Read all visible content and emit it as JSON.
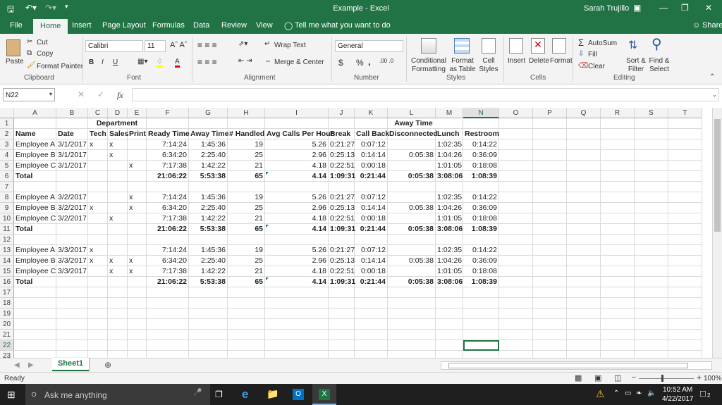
{
  "title": "Example  -  Excel",
  "user": "Sarah Trujillo",
  "tabs": [
    "File",
    "Home",
    "Insert",
    "Page Layout",
    "Formulas",
    "Data",
    "Review",
    "View"
  ],
  "tell_me": "Tell me what you want to do",
  "share": "Share",
  "clipboard": {
    "paste": "Paste",
    "cut": "Cut",
    "copy": "Copy",
    "format_painter": "Format Painter",
    "label": "Clipboard"
  },
  "font": {
    "name": "Calibri",
    "size": "11",
    "label": "Font",
    "bold": "B",
    "italic": "I",
    "underline": "U"
  },
  "alignment": {
    "wrap": "Wrap Text",
    "merge": "Merge & Center",
    "label": "Alignment"
  },
  "number": {
    "format": "General",
    "currency": "$",
    "percent": "%",
    "comma": ",",
    "label": "Number"
  },
  "styles": {
    "conditional": "Conditional Formatting",
    "format_table": "Format as Table",
    "cell_styles": "Cell Styles",
    "label": "Styles"
  },
  "cells": {
    "insert": "Insert",
    "delete": "Delete",
    "format": "Format",
    "label": "Cells"
  },
  "editing": {
    "autosum": "AutoSum",
    "fill": "Fill",
    "clear": "Clear",
    "sort": "Sort & Filter",
    "find": "Find & Select",
    "label": "Editing"
  },
  "formula_bar": {
    "name_box": "N22",
    "fx": "fx",
    "value": ""
  },
  "columns": [
    "A",
    "B",
    "C",
    "D",
    "E",
    "F",
    "G",
    "H",
    "I",
    "J",
    "K",
    "L",
    "M",
    "N",
    "O",
    "P",
    "Q",
    "R",
    "S",
    "T"
  ],
  "rows": [
    {
      "n": "1",
      "c": {
        "D": "Department",
        "L": "Away Time"
      }
    },
    {
      "n": "2",
      "bold": true,
      "c": {
        "A": "Name",
        "B": "Date",
        "C": "Tech",
        "D": "Sales",
        "E": "Print",
        "F": "Ready Time",
        "G": "Away Time",
        "H": "# Handled",
        "I": "Avg Calls Per Hour",
        "J": "Break",
        "K": "Call Back",
        "L": "Disconnected",
        "M": "Lunch",
        "N": "Restroom"
      }
    },
    {
      "n": "3",
      "c": {
        "A": "Employee A",
        "B": "3/1/2017",
        "C": "x",
        "D": "x",
        "F": "7:14:24",
        "G": "1:45:36",
        "H": "19",
        "I": "5.26",
        "J": "0:21:27",
        "K": "0:07:12",
        "M": "1:02:35",
        "N": "0:14:22"
      }
    },
    {
      "n": "4",
      "c": {
        "A": "Employee B",
        "B": "3/1/2017",
        "D": "x",
        "F": "6:34:20",
        "G": "2:25:40",
        "H": "25",
        "I": "2.96",
        "J": "0:25:13",
        "K": "0:14:14",
        "L": "0:05:38",
        "M": "1:04:26",
        "N": "0:36:09"
      }
    },
    {
      "n": "5",
      "c": {
        "A": "Employee C",
        "B": "3/1/2017",
        "E": "x",
        "F": "7:17:38",
        "G": "1:42:22",
        "H": "21",
        "I": "4.18",
        "J": "0:22:51",
        "K": "0:00:18",
        "M": "1:01:05",
        "N": "0:18:08"
      }
    },
    {
      "n": "6",
      "bold": true,
      "c": {
        "A": "Total",
        "F": "21:06:22",
        "G": "5:53:38",
        "H": "65",
        "I": "4.14",
        "J": "1:09:31",
        "K": "0:21:44",
        "L": "0:05:38",
        "M": "3:08:06",
        "N": "1:08:39"
      }
    },
    {
      "n": "7",
      "c": {}
    },
    {
      "n": "8",
      "c": {
        "A": "Employee A",
        "B": "3/2/2017",
        "E": "x",
        "F": "7:14:24",
        "G": "1:45:36",
        "H": "19",
        "I": "5.26",
        "J": "0:21:27",
        "K": "0:07:12",
        "M": "1:02:35",
        "N": "0:14:22"
      }
    },
    {
      "n": "9",
      "c": {
        "A": "Employee B",
        "B": "3/2/2017",
        "C": "x",
        "E": "x",
        "F": "6:34:20",
        "G": "2:25:40",
        "H": "25",
        "I": "2.96",
        "J": "0:25:13",
        "K": "0:14:14",
        "L": "0:05:38",
        "M": "1:04:26",
        "N": "0:36:09"
      }
    },
    {
      "n": "10",
      "c": {
        "A": "Employee C",
        "B": "3/2/2017",
        "D": "x",
        "F": "7:17:38",
        "G": "1:42:22",
        "H": "21",
        "I": "4.18",
        "J": "0:22:51",
        "K": "0:00:18",
        "M": "1:01:05",
        "N": "0:18:08"
      }
    },
    {
      "n": "11",
      "bold": true,
      "c": {
        "A": "Total",
        "F": "21:06:22",
        "G": "5:53:38",
        "H": "65",
        "I": "4.14",
        "J": "1:09:31",
        "K": "0:21:44",
        "L": "0:05:38",
        "M": "3:08:06",
        "N": "1:08:39"
      }
    },
    {
      "n": "12",
      "c": {}
    },
    {
      "n": "13",
      "c": {
        "A": "Employee A",
        "B": "3/3/2017",
        "C": "x",
        "F": "7:14:24",
        "G": "1:45:36",
        "H": "19",
        "I": "5.26",
        "J": "0:21:27",
        "K": "0:07:12",
        "M": "1:02:35",
        "N": "0:14:22"
      }
    },
    {
      "n": "14",
      "c": {
        "A": "Employee B",
        "B": "3/3/2017",
        "C": "x",
        "D": "x",
        "E": "x",
        "F": "6:34:20",
        "G": "2:25:40",
        "H": "25",
        "I": "2.96",
        "J": "0:25:13",
        "K": "0:14:14",
        "L": "0:05:38",
        "M": "1:04:26",
        "N": "0:36:09"
      }
    },
    {
      "n": "15",
      "c": {
        "A": "Employee C",
        "B": "3/3/2017",
        "D": "x",
        "E": "x",
        "F": "7:17:38",
        "G": "1:42:22",
        "H": "21",
        "I": "4.18",
        "J": "0:22:51",
        "K": "0:00:18",
        "M": "1:01:05",
        "N": "0:18:08"
      }
    },
    {
      "n": "16",
      "bold": true,
      "c": {
        "A": "Total",
        "F": "21:06:22",
        "G": "5:53:38",
        "H": "65",
        "I": "4.14",
        "J": "1:09:31",
        "K": "0:21:44",
        "L": "0:05:38",
        "M": "3:08:06",
        "N": "1:08:39"
      }
    },
    {
      "n": "17",
      "c": {}
    },
    {
      "n": "18",
      "c": {}
    },
    {
      "n": "19",
      "c": {}
    },
    {
      "n": "20",
      "c": {}
    },
    {
      "n": "21",
      "c": {}
    },
    {
      "n": "22",
      "c": {}
    },
    {
      "n": "23",
      "c": {}
    }
  ],
  "sheet_tab": "Sheet1",
  "status": "Ready",
  "zoom": "100%",
  "taskbar": {
    "search": "Ask me anything",
    "time": "10:52 AM",
    "date": "4/22/2017",
    "notifications": "2"
  }
}
